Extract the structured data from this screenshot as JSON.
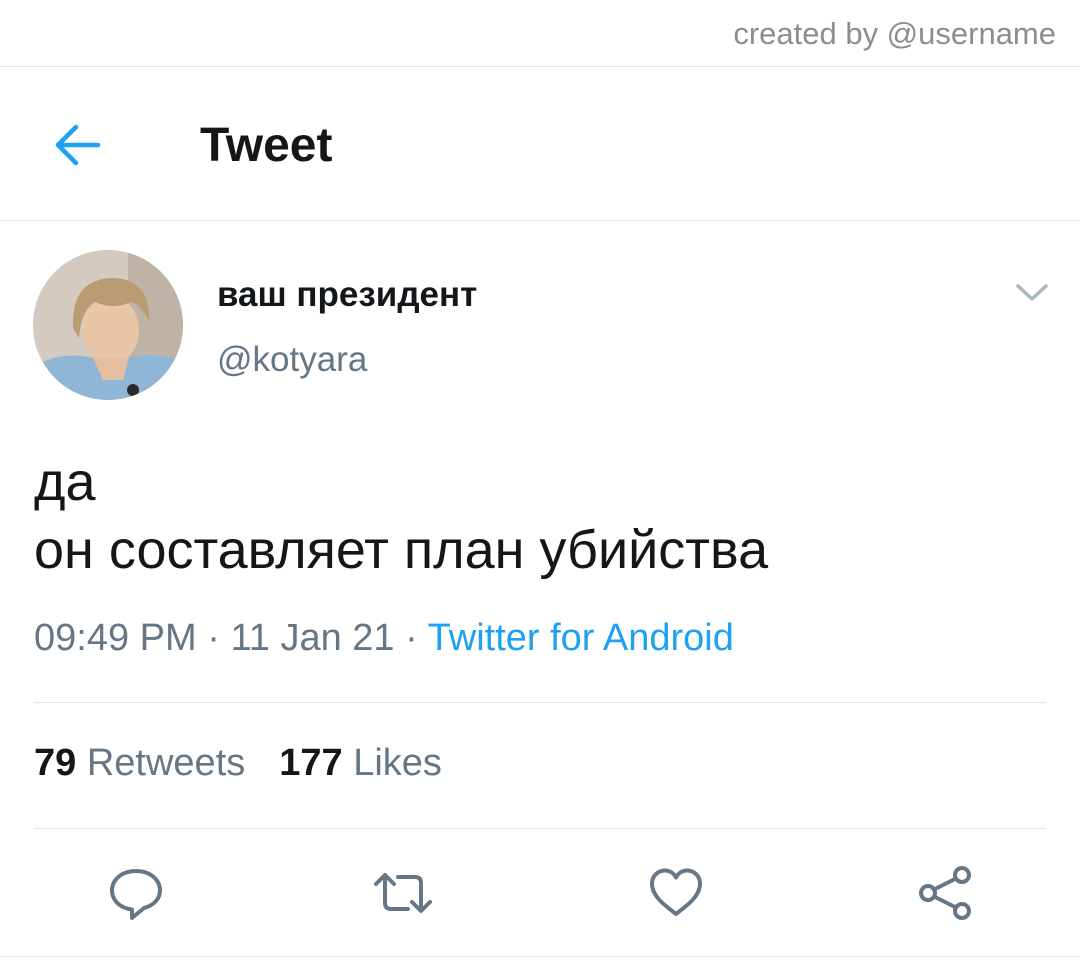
{
  "watermark": "created by @username",
  "header": {
    "back_icon": "arrow-left-icon",
    "title": "Tweet"
  },
  "author": {
    "name": "ваш президент",
    "handle": "@kotyara",
    "menu_icon": "chevron-down-icon"
  },
  "tweet": {
    "line1": "да",
    "line2": "он составляет план убийства",
    "time": "09:49 PM",
    "sep1": " · ",
    "date": "11 Jan 21",
    "sep2": " · ",
    "source": "Twitter for Android"
  },
  "stats": {
    "retweets_count": "79",
    "retweets_label": "Retweets",
    "likes_count": "177",
    "likes_label": "Likes"
  },
  "actions": [
    "reply-icon",
    "retweet-icon",
    "like-icon",
    "share-icon"
  ],
  "colors": {
    "accent": "#1da1f2",
    "text": "#14171a",
    "muted": "#657786",
    "divider": "#e1e4e6"
  }
}
